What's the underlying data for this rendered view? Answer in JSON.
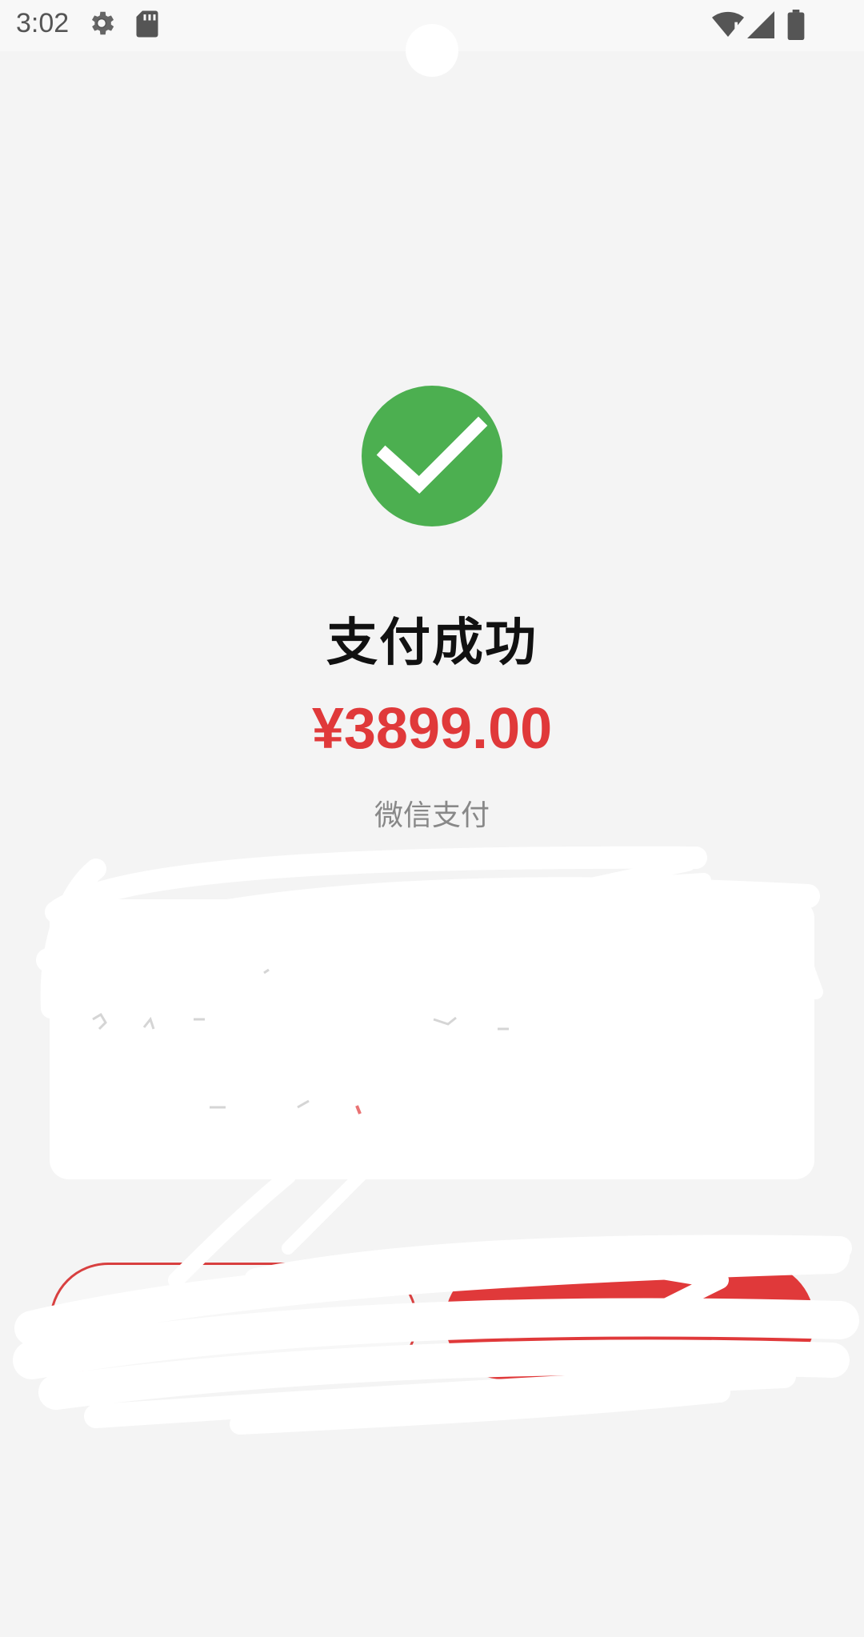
{
  "status_bar": {
    "time": "3:02",
    "icons": [
      "gear-icon",
      "sd-card-icon",
      "wifi-alert-icon",
      "cellular-signal-icon",
      "battery-icon"
    ]
  },
  "success": {
    "icon": "check-circle-icon",
    "title": "支付成功",
    "amount": "¥3899.00",
    "method": "微信支付"
  },
  "colors": {
    "success_green": "#4caf50",
    "accent_red": "#e0393a",
    "background": "#f4f4f4",
    "card": "#ffffff"
  }
}
